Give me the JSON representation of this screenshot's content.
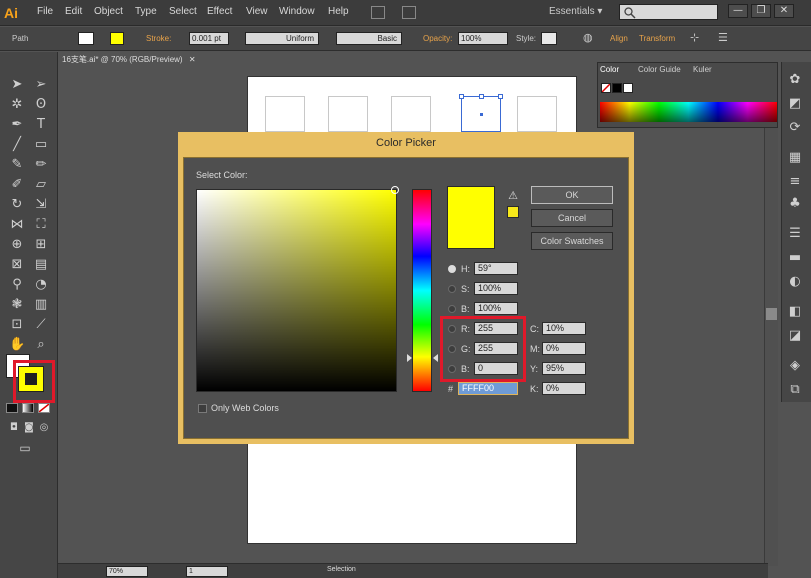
{
  "app": {
    "logo": "Ai",
    "menus": [
      "File",
      "Edit",
      "Object",
      "Type",
      "Select",
      "Effect",
      "View",
      "Window",
      "Help"
    ],
    "workspace": "Essentials",
    "workspace_arrow": "▾",
    "window_buttons": [
      "—",
      "❐",
      "✕"
    ]
  },
  "control_bar": {
    "selection_type": "Path",
    "stroke_label": "Stroke:",
    "stroke_weight": "0.001 pt",
    "profile": "Uniform",
    "brush": "Basic",
    "opacity_label": "Opacity:",
    "opacity": "100%",
    "style_label": "Style:",
    "align_label": "Align",
    "transform_label": "Transform"
  },
  "document": {
    "tab_title": "16支笔.ai* @ 70% (RGB/Preview)",
    "tab_close": "✕"
  },
  "color_panel": {
    "tabs": [
      "Color",
      "Color Guide",
      "Kuler"
    ]
  },
  "status_bar": {
    "zoom": "70%",
    "artboard_number": "1",
    "tool_name": "Selection"
  },
  "color_picker": {
    "title": "Color Picker",
    "select_color_label": "Select Color:",
    "ok_label": "OK",
    "cancel_label": "Cancel",
    "swatches_label": "Color Swatches",
    "warning_icon": "⚠",
    "new_color": "#ffff00",
    "gamut_color": "#f7e81a",
    "hsb": {
      "h_label": "H:",
      "h": "59°",
      "s_label": "S:",
      "s": "100%",
      "b_label": "B:",
      "b": "100%"
    },
    "rgb": {
      "r_label": "R:",
      "r": "255",
      "g_label": "G:",
      "g": "255",
      "b_label": "B:",
      "b": "0"
    },
    "cmyk": {
      "c_label": "C:",
      "c": "10%",
      "m_label": "M:",
      "m": "0%",
      "y_label": "Y:",
      "y": "95%",
      "k_label": "K:",
      "k": "0%"
    },
    "hex_label": "#",
    "hex": "FFFF00",
    "only_web_colors": "Only Web Colors"
  },
  "tools": {
    "fill_color": "#ffff00",
    "stroke_color": "#ffffff"
  }
}
